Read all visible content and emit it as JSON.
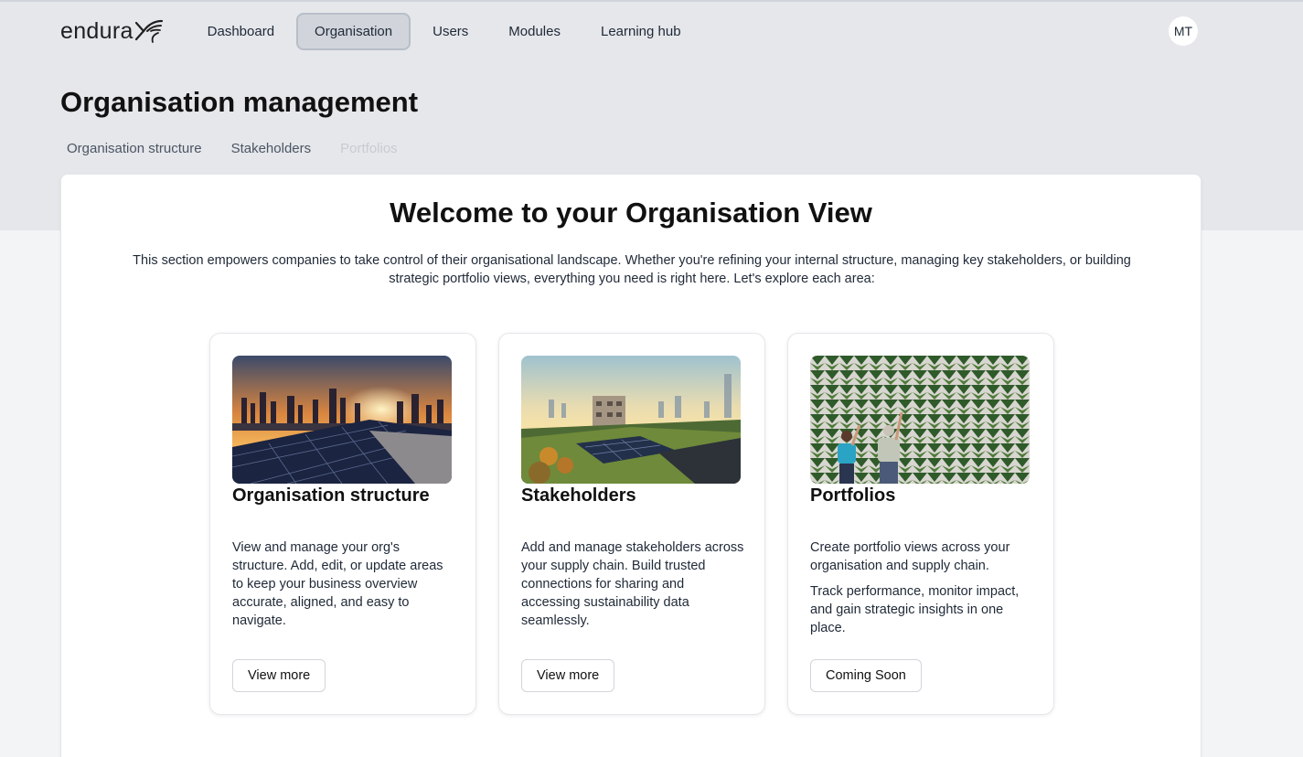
{
  "brand": {
    "name": "endura"
  },
  "nav": {
    "links": [
      "Dashboard",
      "Organisation",
      "Users",
      "Modules",
      "Learning hub"
    ],
    "active": "Organisation"
  },
  "user": {
    "initials": "MT"
  },
  "page": {
    "title": "Organisation management"
  },
  "subnav": {
    "items": [
      "Organisation structure",
      "Stakeholders",
      "Portfolios"
    ],
    "disabled": [
      "Portfolios"
    ]
  },
  "welcome": {
    "title": "Welcome to your Organisation View",
    "intro_line1": "This section empowers companies to take control of their organisational landscape. Whether you're refining your internal structure, managing key stakeholders, or building",
    "intro_line2": "strategic portfolio views, everything you need is right here. Let's explore each area:"
  },
  "cards": [
    {
      "title": "Organisation structure",
      "desc": [
        "View and manage your org's structure. Add, edit, or update areas to keep your business overview accurate, aligned, and easy to navigate."
      ],
      "button": "View more",
      "image": "solar-panels-city-sunset"
    },
    {
      "title": "Stakeholders",
      "desc": [
        "Add and manage stakeholders across your supply chain. Build trusted connections for sharing and accessing sustainability data seamlessly."
      ],
      "button": "View more",
      "image": "green-roof-solar-city"
    },
    {
      "title": "Portfolios",
      "desc": [
        "Create portfolio views across your organisation and supply chain.",
        "Track performance, monitor impact, and gain strategic insights in one place."
      ],
      "button": "Coming Soon",
      "image": "green-wall-people"
    }
  ]
}
